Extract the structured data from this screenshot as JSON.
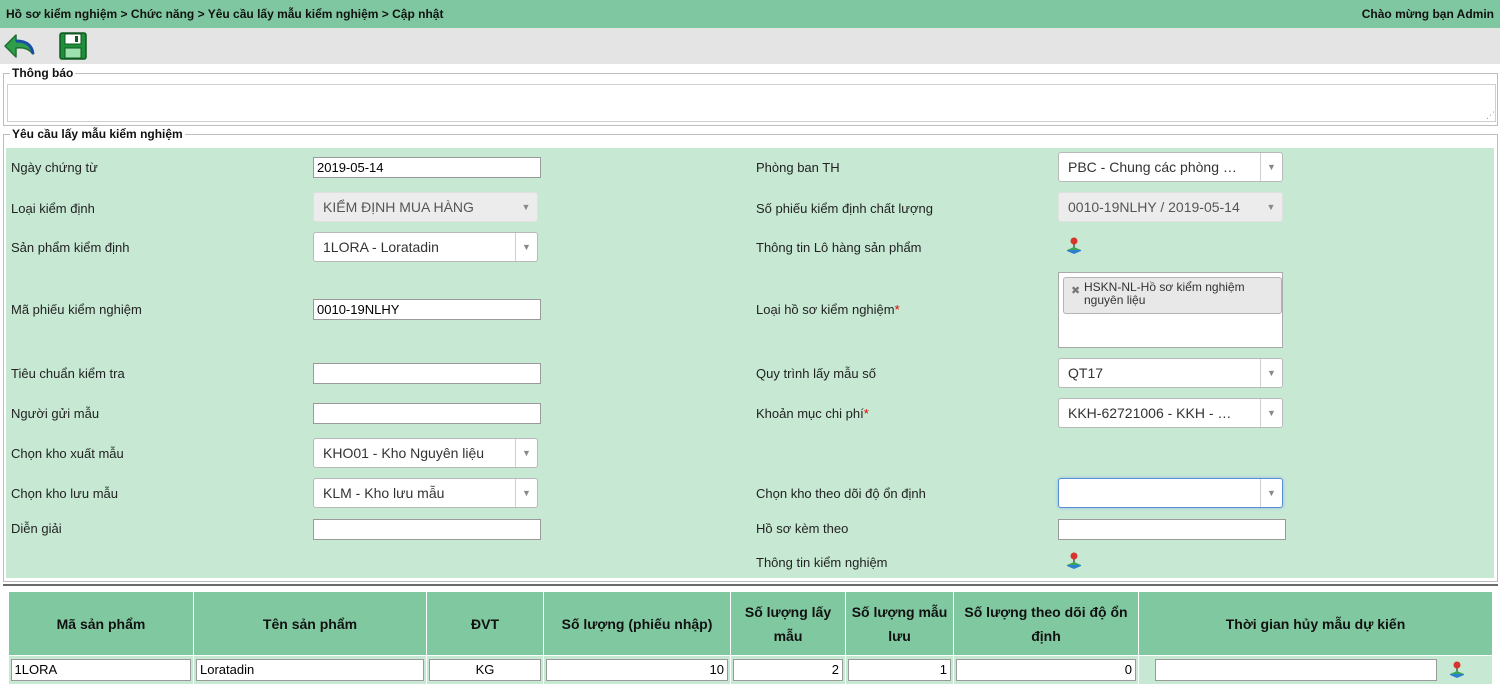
{
  "header": {
    "breadcrumb": "Hồ sơ kiểm nghiệm > Chức năng > Yêu cầu lấy mẫu kiểm nghiệm > Cập nhật",
    "welcome": "Chào mừng bạn Admin"
  },
  "toolbar": {
    "back_icon": "back-arrow-icon",
    "save_icon": "floppy-disk-icon"
  },
  "notice": {
    "legend": "Thông báo",
    "value": ""
  },
  "form": {
    "legend": "Yêu cầu lấy mẫu kiểm nghiệm",
    "left": {
      "ngay_chung_tu": {
        "label": "Ngày chứng từ",
        "value": "2019-05-14"
      },
      "loai_kiem_dinh": {
        "label": "Loại kiểm định",
        "value": "KIỂM ĐỊNH MUA HÀNG"
      },
      "san_pham_kiem_dinh": {
        "label": "Sản phẩm kiểm định",
        "value": "1LORA - Loratadin"
      },
      "ma_phieu_kiem_nghiem": {
        "label": "Mã phiếu kiểm nghiệm",
        "value": "0010-19NLHY"
      },
      "tieu_chuan_kiem_tra": {
        "label": "Tiêu chuẩn kiểm tra",
        "value": ""
      },
      "nguoi_gui_mau": {
        "label": "Người gửi mẫu",
        "value": ""
      },
      "kho_xuat_mau": {
        "label": "Chọn kho xuất mẫu",
        "value": "KHO01 - Kho Nguyên liệu"
      },
      "kho_luu_mau": {
        "label": "Chọn kho lưu mẫu",
        "value": "KLM - Kho lưu mẫu"
      },
      "dien_giai": {
        "label": "Diễn giải",
        "value": ""
      }
    },
    "right": {
      "phong_ban_th": {
        "label": "Phòng ban TH",
        "value": "PBC - Chung các phòng …"
      },
      "so_phieu_kdcl": {
        "label": "Số phiếu kiểm định chất lượng",
        "value": "0010-19NLHY / 2019-05-14"
      },
      "thong_tin_lo_hang": {
        "label": "Thông tin Lô hàng sản phẩm"
      },
      "loai_ho_so": {
        "label": "Loại hồ sơ kiểm nghiệm",
        "required": "*",
        "chip": "HSKN-NL-Hồ sơ kiểm nghiệm nguyên liệu"
      },
      "quy_trinh_lay_mau": {
        "label": "Quy trình lấy mẫu số",
        "value": "QT17"
      },
      "khoan_muc_chi_phi": {
        "label": "Khoản mục chi phí",
        "required": "*",
        "value": "KKH-62721006 - KKH - …"
      },
      "kho_theo_doi_on_dinh": {
        "label": "Chọn kho theo dõi độ ổn định",
        "value": ""
      },
      "ho_so_kem_theo": {
        "label": "Hồ sơ kèm theo",
        "value": ""
      },
      "thong_tin_kiem_nghiem": {
        "label": "Thông tin kiểm nghiệm"
      }
    }
  },
  "table": {
    "columns": [
      "Mã sản phẩm",
      "Tên sản phẩm",
      "ĐVT",
      "Số lượng (phiếu nhập)",
      "Số lượng lấy mẫu",
      "Số lượng mẫu lưu",
      "Số lượng theo dõi độ ổn định",
      "Thời gian hủy mẫu dự kiến"
    ],
    "rows": [
      {
        "ma_san_pham": "1LORA",
        "ten_san_pham": "Loratadin",
        "dvt": "KG",
        "so_luong_phieu_nhap": "10",
        "so_luong_lay_mau": "2",
        "so_luong_mau_luu": "1",
        "so_luong_theo_doi": "0",
        "thoi_gian_huy": ""
      }
    ]
  },
  "colors": {
    "header_green": "#7fc7a0",
    "form_green": "#c7e9d3",
    "toolbar_gray": "#e4e4e4",
    "required_red": "#e00000"
  }
}
